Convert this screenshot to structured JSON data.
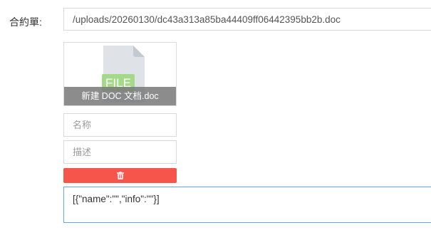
{
  "form": {
    "contract_label": "合約單:",
    "file_path": "/uploads/20260130/dc43a313a85ba44409ff06442395bb2b.doc"
  },
  "file_card": {
    "icon": "file-icon",
    "icon_text": "FILE",
    "file_name": "新建 DOC 文档.doc"
  },
  "name_field": {
    "placeholder": "名称",
    "value": ""
  },
  "desc_field": {
    "placeholder": "描述",
    "value": ""
  },
  "delete_button": {
    "icon": "trash-icon",
    "color": "#f5554a"
  },
  "json_field": {
    "value": "[{\"name\":\"\",\"info\":\"\"}]"
  },
  "colors": {
    "focus_border": "#66a6e0",
    "icon_label_green": "#9bd67a",
    "caption_bg": "#787878"
  }
}
